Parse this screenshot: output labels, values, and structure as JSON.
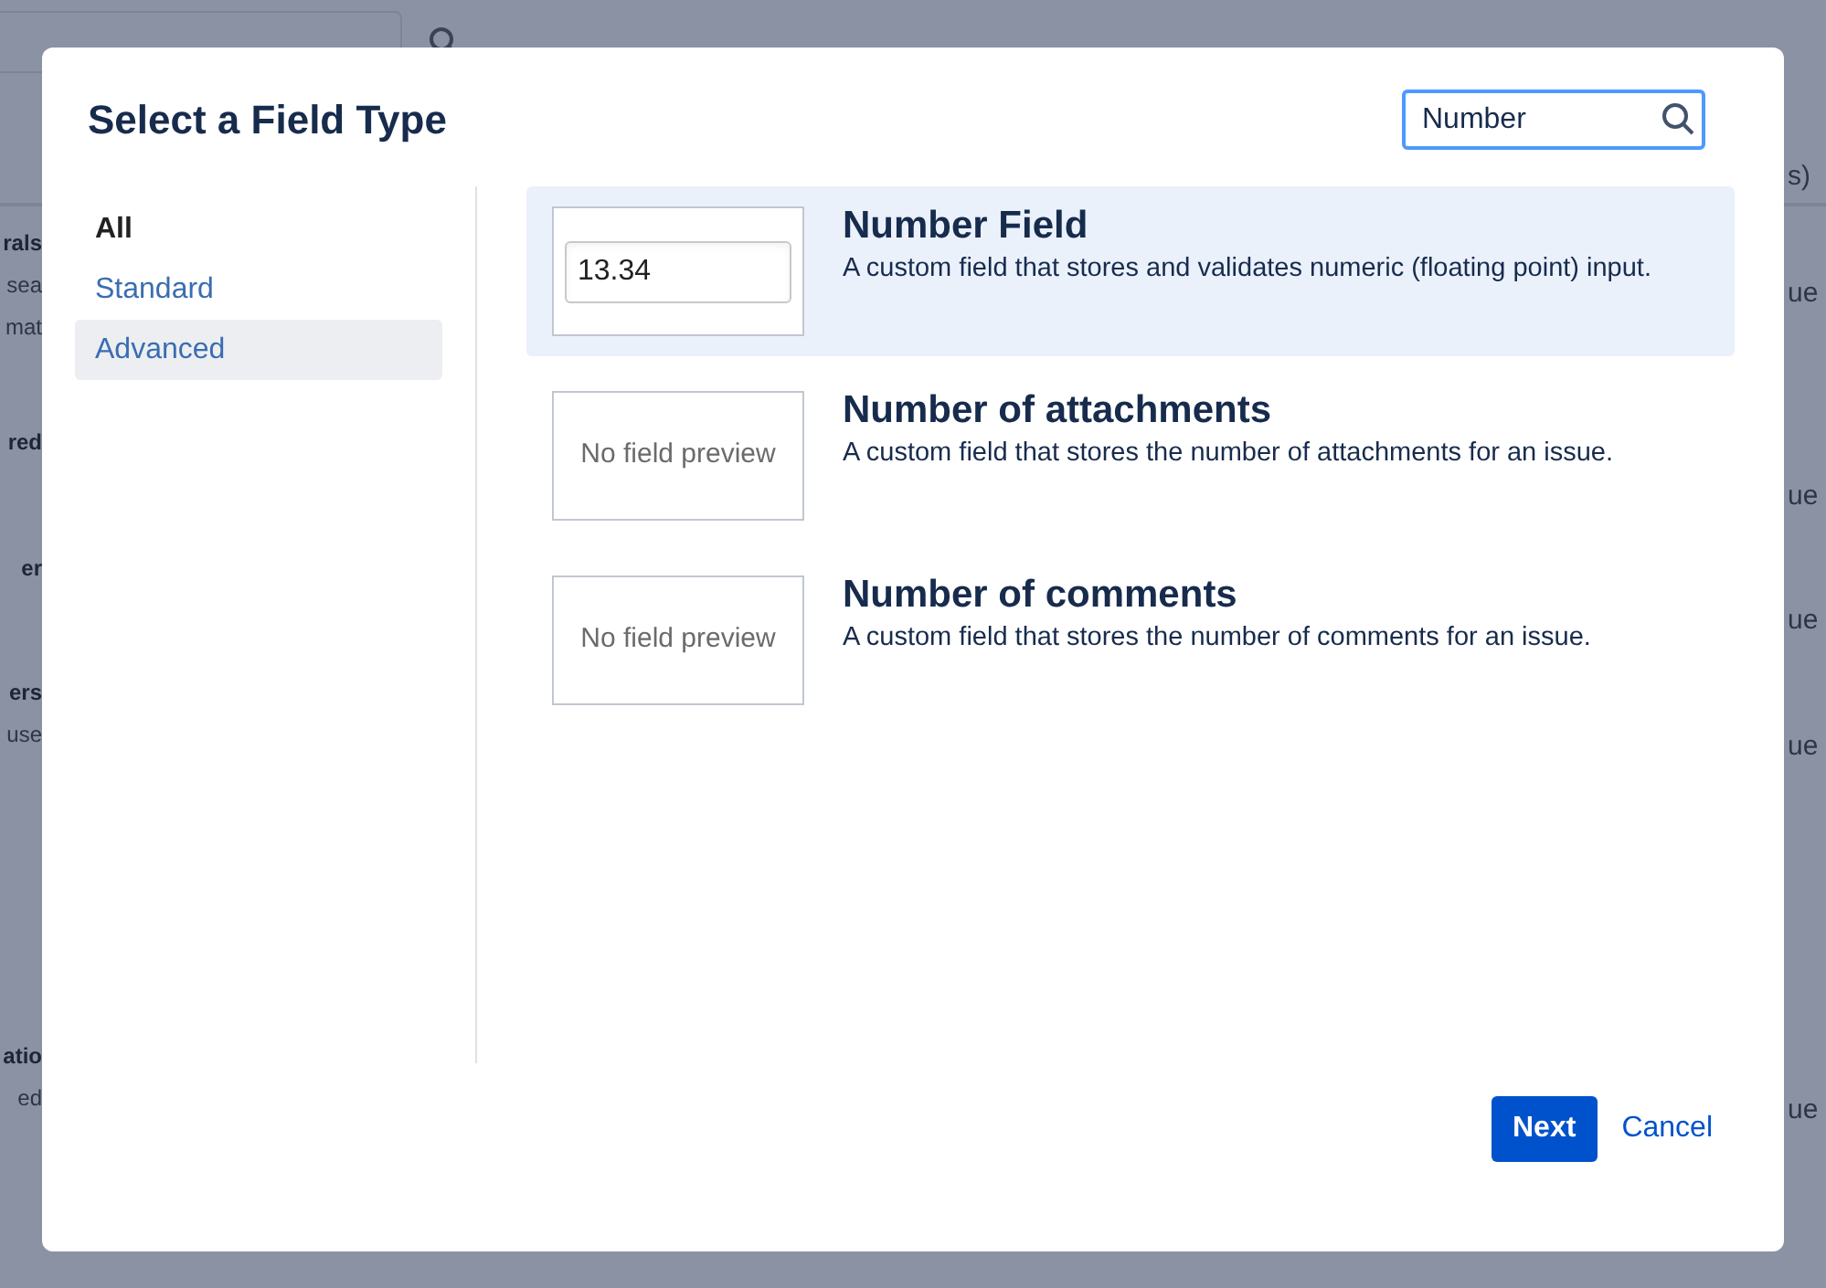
{
  "background": {
    "left_fragments": [
      {
        "text": "rals",
        "kind": "heading"
      },
      {
        "text": "sea",
        "kind": "body"
      },
      {
        "text": "mat",
        "kind": "body"
      },
      {
        "text": "red",
        "kind": "heading"
      },
      {
        "text": "er",
        "kind": "heading"
      },
      {
        "text": "ers",
        "kind": "heading"
      },
      {
        "text": "use",
        "kind": "body"
      },
      {
        "text": "atio",
        "kind": "heading"
      },
      {
        "text": "ed",
        "kind": "body"
      }
    ],
    "right_fragments": [
      "s)",
      "ue",
      "ue",
      "ue",
      "ue",
      "ue"
    ]
  },
  "dialog": {
    "title": "Select a Field Type",
    "search": {
      "value": "Number"
    },
    "categories": [
      {
        "label": "All",
        "kind": "heading",
        "selected": false
      },
      {
        "label": "Standard",
        "kind": "link",
        "selected": false
      },
      {
        "label": "Advanced",
        "kind": "link",
        "selected": true
      }
    ],
    "fields": [
      {
        "name": "Number Field",
        "description": "A custom field that stores and validates numeric (floating point) input.",
        "preview": {
          "kind": "input",
          "value": "13.34"
        },
        "selected": true
      },
      {
        "name": "Number of attachments",
        "description": "A custom field that stores the number of attachments for an issue.",
        "preview": {
          "kind": "none",
          "text": "No field preview"
        },
        "selected": false
      },
      {
        "name": "Number of comments",
        "description": "A custom field that stores the number of comments for an issue.",
        "preview": {
          "kind": "none",
          "text": "No field preview"
        },
        "selected": false
      }
    ],
    "buttons": {
      "primary": "Next",
      "secondary": "Cancel"
    }
  }
}
